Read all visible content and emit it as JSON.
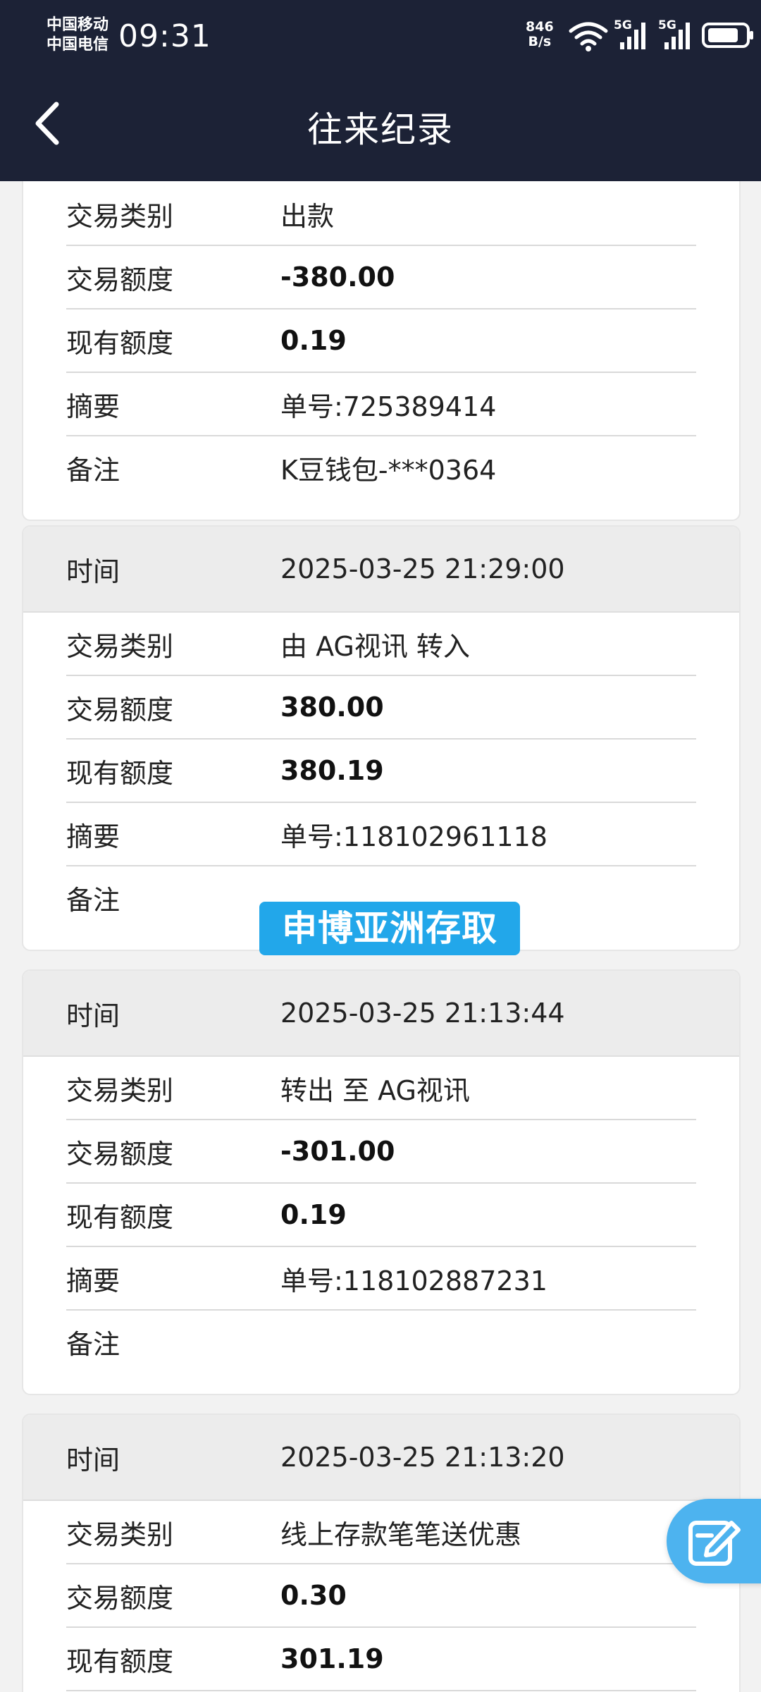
{
  "status_bar": {
    "carrier_1": "中国移动",
    "carrier_2": "中国电信",
    "time": "09:31",
    "net_speed_value": "846",
    "net_speed_unit": "B/s",
    "signal_1_label": "5G",
    "signal_2_label": "5G",
    "icons": [
      "wifi-icon",
      "signal-icon",
      "signal-icon",
      "battery-icon"
    ]
  },
  "header": {
    "title": "往来纪录",
    "back_icon": "chevron-left-icon"
  },
  "watermark": "申博亚洲存取",
  "records": [
    {
      "rows": [
        {
          "label": "交易类别",
          "value": "出款",
          "bold": false
        },
        {
          "label": "交易额度",
          "value": "-380.00",
          "bold": true
        },
        {
          "label": "现有额度",
          "value": "0.19",
          "bold": true
        },
        {
          "label": "摘要",
          "value": "单号:725389414",
          "bold": false
        },
        {
          "label": "备注",
          "value": "K豆钱包-***0364",
          "bold": false
        }
      ]
    },
    {
      "time_label": "时间",
      "time_value": "2025-03-25 21:29:00",
      "rows": [
        {
          "label": "交易类别",
          "value": "由 AG视讯 转入",
          "bold": false
        },
        {
          "label": "交易额度",
          "value": "380.00",
          "bold": true
        },
        {
          "label": "现有额度",
          "value": "380.19",
          "bold": true
        },
        {
          "label": "摘要",
          "value": "单号:118102961118",
          "bold": false
        },
        {
          "label": "备注",
          "value": "",
          "bold": false
        }
      ]
    },
    {
      "time_label": "时间",
      "time_value": "2025-03-25 21:13:44",
      "rows": [
        {
          "label": "交易类别",
          "value": "转出 至 AG视讯",
          "bold": false
        },
        {
          "label": "交易额度",
          "value": "-301.00",
          "bold": true
        },
        {
          "label": "现有额度",
          "value": "0.19",
          "bold": true
        },
        {
          "label": "摘要",
          "value": "单号:118102887231",
          "bold": false
        },
        {
          "label": "备注",
          "value": "",
          "bold": false
        }
      ]
    },
    {
      "time_label": "时间",
      "time_value": "2025-03-25 21:13:20",
      "rows": [
        {
          "label": "交易类别",
          "value": "线上存款笔笔送优惠",
          "bold": false
        },
        {
          "label": "交易额度",
          "value": "0.30",
          "bold": true
        },
        {
          "label": "现有额度",
          "value": "301.19",
          "bold": true
        }
      ]
    }
  ],
  "fab_icon": "edit-icon",
  "colors": {
    "header_bg": "#1c2236",
    "page_bg": "#f2f2f2",
    "card_head_bg": "#ececec",
    "fab_bg": "#4db3ef",
    "watermark_bg": "#22a7ea"
  }
}
